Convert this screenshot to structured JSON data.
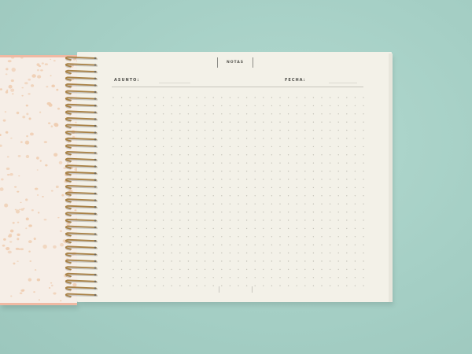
{
  "header": {
    "title": "NOTAS"
  },
  "fields": {
    "subject_label": "ASUNTO:",
    "date_label": "FECHA:"
  },
  "colors": {
    "background": "#a7d0c6",
    "page": "#f3f1e8",
    "cover": "#f6eee7",
    "cover_dots": "#efcdb1",
    "cover_edge": "#f0b9a3",
    "spiral": "#a98246",
    "grid_dots": "#c4c2b8"
  },
  "icons": [
    "spiral-binding",
    "dot-grid"
  ]
}
